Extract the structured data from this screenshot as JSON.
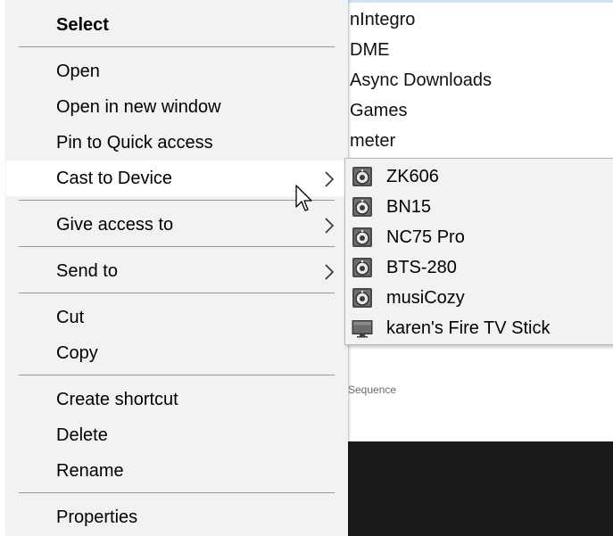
{
  "background_items": [
    "nIntegro",
    "DME",
    "Async Downloads",
    "Games",
    "meter"
  ],
  "background_note": "e Sequence",
  "menu": {
    "items": [
      {
        "label": "Select",
        "bold": true
      },
      {
        "label": "Open"
      },
      {
        "label": "Open in new window"
      },
      {
        "label": "Pin to Quick access"
      },
      {
        "label": "Cast to Device",
        "submenu": true,
        "highlighted": true
      },
      {
        "label": "Give access to",
        "submenu": true
      },
      {
        "label": "Send to",
        "submenu": true
      },
      {
        "label": "Cut"
      },
      {
        "label": "Copy"
      },
      {
        "label": "Create shortcut"
      },
      {
        "label": "Delete"
      },
      {
        "label": "Rename"
      },
      {
        "label": "Properties"
      }
    ]
  },
  "submenu": {
    "items": [
      {
        "label": "ZK606",
        "icon": "speaker-icon"
      },
      {
        "label": "BN15",
        "icon": "speaker-icon"
      },
      {
        "label": "NC75 Pro",
        "icon": "speaker-icon"
      },
      {
        "label": "BTS-280",
        "icon": "speaker-icon"
      },
      {
        "label": "musiCozy",
        "icon": "speaker-icon"
      },
      {
        "label": "karen's Fire TV Stick",
        "icon": "tv-icon"
      }
    ]
  },
  "colors": {
    "menu_bg": "#f2f2f2",
    "highlight_bg": "#ffffff",
    "separator": "#999999"
  }
}
